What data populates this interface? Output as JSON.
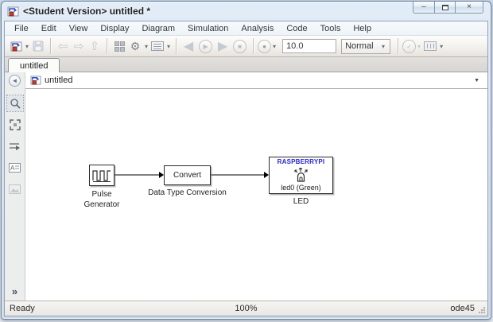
{
  "window": {
    "title": "<Student Version> untitled *"
  },
  "menubar": {
    "items": [
      "File",
      "Edit",
      "View",
      "Display",
      "Diagram",
      "Simulation",
      "Analysis",
      "Code",
      "Tools",
      "Help"
    ]
  },
  "toolbar": {
    "sim_time": "10.0",
    "sim_mode": "Normal"
  },
  "tabs": {
    "active": "untitled"
  },
  "breadcrumb": {
    "model": "untitled"
  },
  "canvas": {
    "pulse_label": "Pulse\nGenerator",
    "convert_text": "Convert",
    "convert_label": "Data Type Conversion",
    "led_header": "RASPBERRYPI",
    "led_sub": "led0 (Green)",
    "led_label": "LED"
  },
  "statusbar": {
    "state": "Ready",
    "zoom": "100%",
    "solver": "ode45"
  },
  "icons": {
    "caret": "▾",
    "back_arrow": "⇦",
    "forward_arrow": "⇨",
    "up_arrow": "⇧",
    "gear": "⚙",
    "step_back": "◀",
    "play": "▶",
    "step_forward": "▶",
    "stop": "■",
    "record": "●",
    "check": "✓",
    "minimize": "–",
    "close": "×",
    "breadcrumb_caret": "▼",
    "nav_left": "◄",
    "palette_more": "»"
  },
  "colors": {
    "led_text_blue": "#2525d8",
    "model_icon_blue": "#2a52c9",
    "model_icon_red": "#c03a2e"
  }
}
